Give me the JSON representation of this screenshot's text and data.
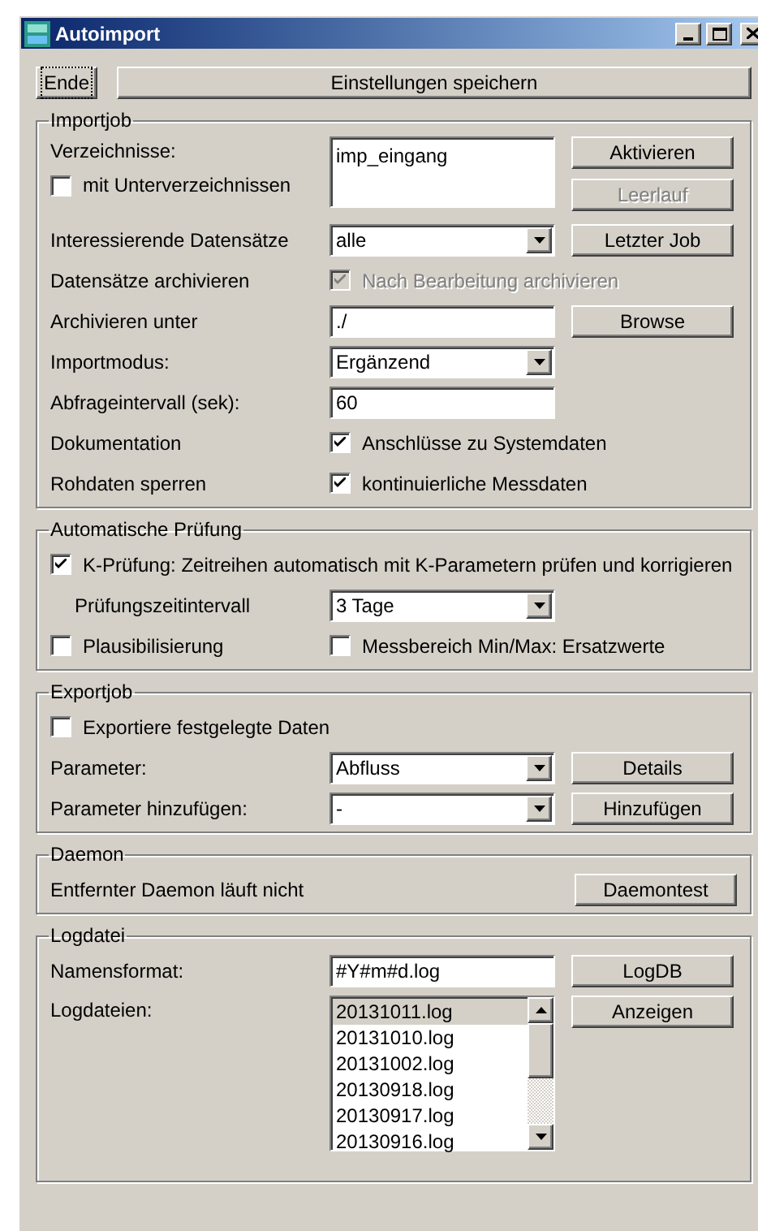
{
  "window": {
    "title": "Autoimport"
  },
  "toolbar": [
    {
      "label": "Ende",
      "focused": true
    },
    {
      "label": "Einstellungen speichern",
      "focused": false
    }
  ],
  "importjob": {
    "title": "Importjob",
    "directories": {
      "label": "Verzeichnisse:",
      "value": "imp_eingang",
      "subdirs": {
        "label": "mit Unterverzeichnissen",
        "checked": false,
        "disabled": false
      },
      "buttons": [
        {
          "label": "Aktivieren",
          "disabled": false
        },
        {
          "label": "Leerlauf",
          "disabled": true
        }
      ]
    },
    "rows": [
      {
        "kind": "select",
        "label": "Interessierende Datensätze",
        "value": "alle",
        "button": "Letzter Job"
      },
      {
        "kind": "checkbox",
        "label": "Datensätze archivieren",
        "check": {
          "label": "Nach Bearbeitung archivieren",
          "checked": true,
          "disabled": true
        }
      },
      {
        "kind": "input",
        "label": "Archivieren unter",
        "value": "./",
        "button": "Browse"
      },
      {
        "kind": "select",
        "label": "Importmodus:",
        "value": "Ergänzend"
      },
      {
        "kind": "input",
        "label": "Abfrageintervall (sek):",
        "value": "60"
      },
      {
        "kind": "checkbox",
        "label": "Dokumentation",
        "check": {
          "label": "Anschlüsse zu Systemdaten",
          "checked": true,
          "disabled": false
        }
      },
      {
        "kind": "checkbox",
        "label": "Rohdaten sperren",
        "check": {
          "label": "kontinuierliche Messdaten",
          "checked": true,
          "disabled": false
        }
      }
    ]
  },
  "pruefung": {
    "title": "Automatische Prüfung",
    "rows": [
      {
        "kind": "check",
        "check": {
          "label": "K-Prüfung: Zeitreihen automatisch mit K-Parametern prüfen und korrigieren",
          "checked": true,
          "disabled": false
        }
      },
      {
        "kind": "subselect",
        "label": "Prüfungszeitintervall",
        "value": "3 Tage"
      },
      {
        "kind": "check_pair",
        "checks": [
          {
            "label": "Plausibilisierung",
            "checked": false,
            "disabled": false
          },
          {
            "label": "Messbereich Min/Max: Ersatzwerte",
            "checked": false,
            "disabled": false
          }
        ]
      }
    ]
  },
  "exportjob": {
    "title": "Exportjob",
    "rows": [
      {
        "kind": "check",
        "check": {
          "label": "Exportiere festgelegte Daten",
          "checked": false,
          "disabled": false
        }
      },
      {
        "kind": "select",
        "label": "Parameter:",
        "value": "Abfluss",
        "button": "Details"
      },
      {
        "kind": "select",
        "label": "Parameter hinzufügen:",
        "value": "-",
        "button": "Hinzufügen"
      }
    ]
  },
  "daemon": {
    "title": "Daemon",
    "rows": [
      {
        "kind": "text",
        "label": "Entfernter Daemon läuft nicht",
        "button": "Daemontest"
      }
    ]
  },
  "logdatei": {
    "title": "Logdatei",
    "rows": [
      {
        "kind": "input",
        "label": "Namensformat:",
        "value": "#Y#m#d.log",
        "button": "LogDB"
      },
      {
        "kind": "list",
        "label": "Logdateien:",
        "button": "Anzeigen",
        "items": [
          {
            "label": "20131011.log",
            "selected": true
          },
          {
            "label": "20131010.log",
            "selected": false
          },
          {
            "label": "20131002.log",
            "selected": false
          },
          {
            "label": "20130918.log",
            "selected": false
          },
          {
            "label": "20130917.log",
            "selected": false
          },
          {
            "label": "20130916.log",
            "selected": false
          }
        ]
      }
    ]
  }
}
